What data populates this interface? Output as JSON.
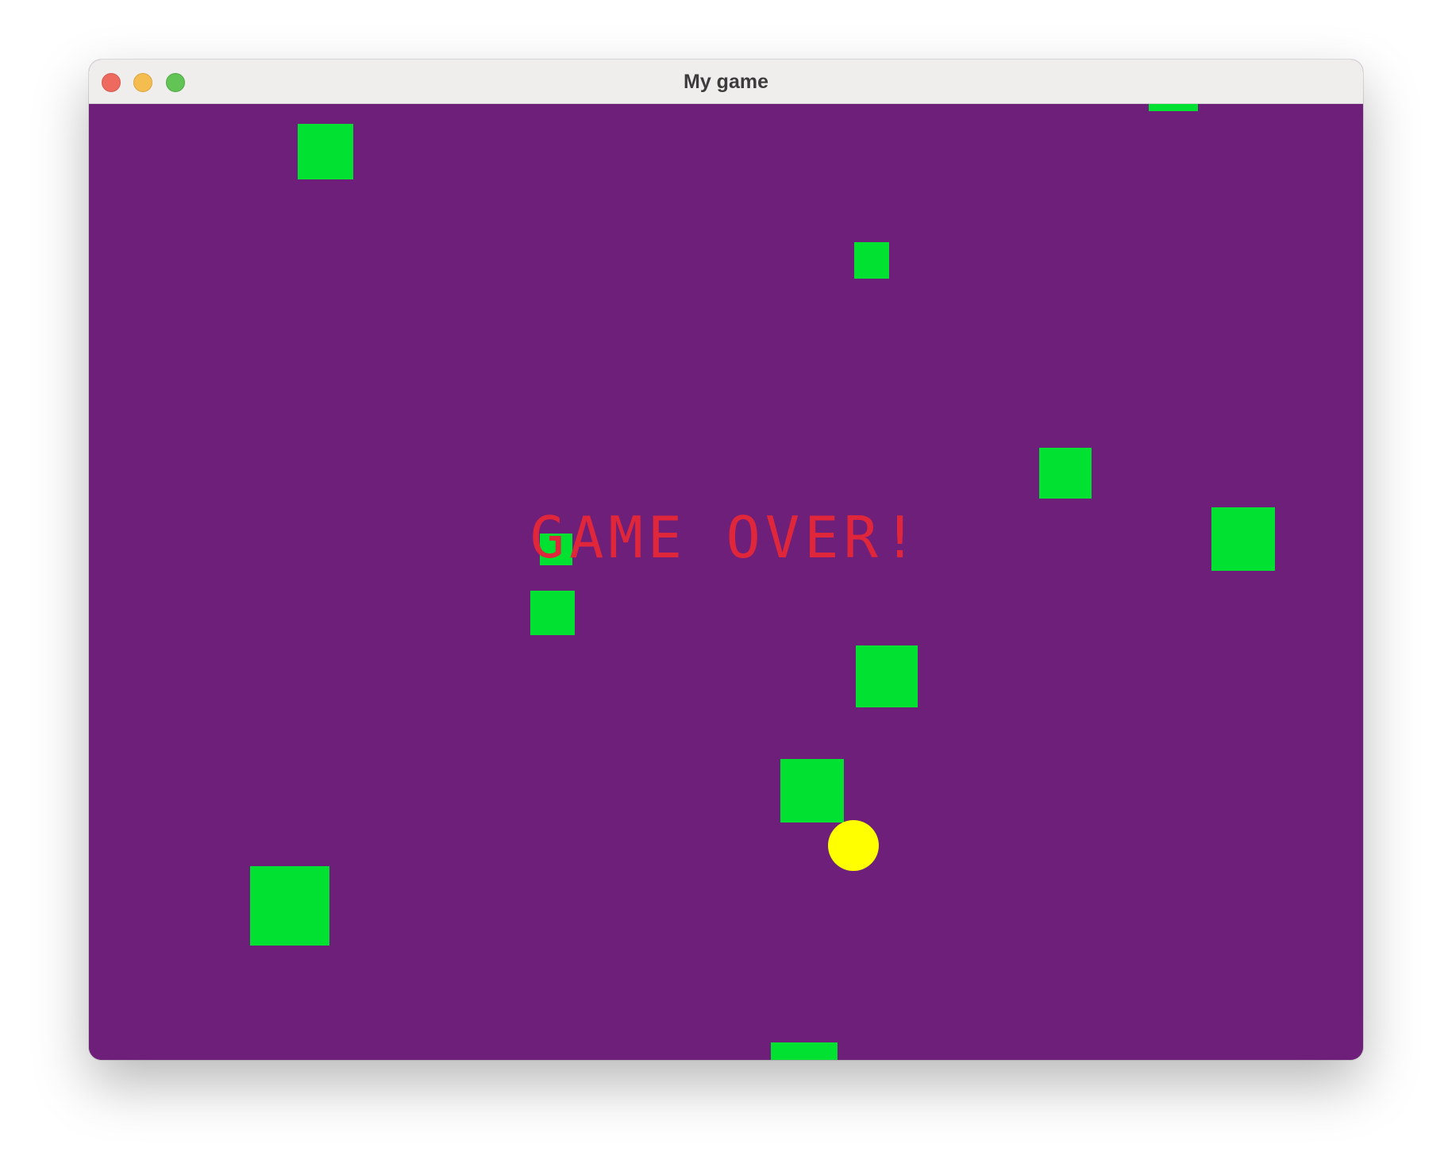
{
  "window": {
    "title": "My game"
  },
  "game": {
    "status_text": "GAME OVER!",
    "colors": {
      "background": "#6e1f79",
      "obstacle": "#00e132",
      "player": "#ffff00",
      "message": "#e0263a"
    }
  }
}
